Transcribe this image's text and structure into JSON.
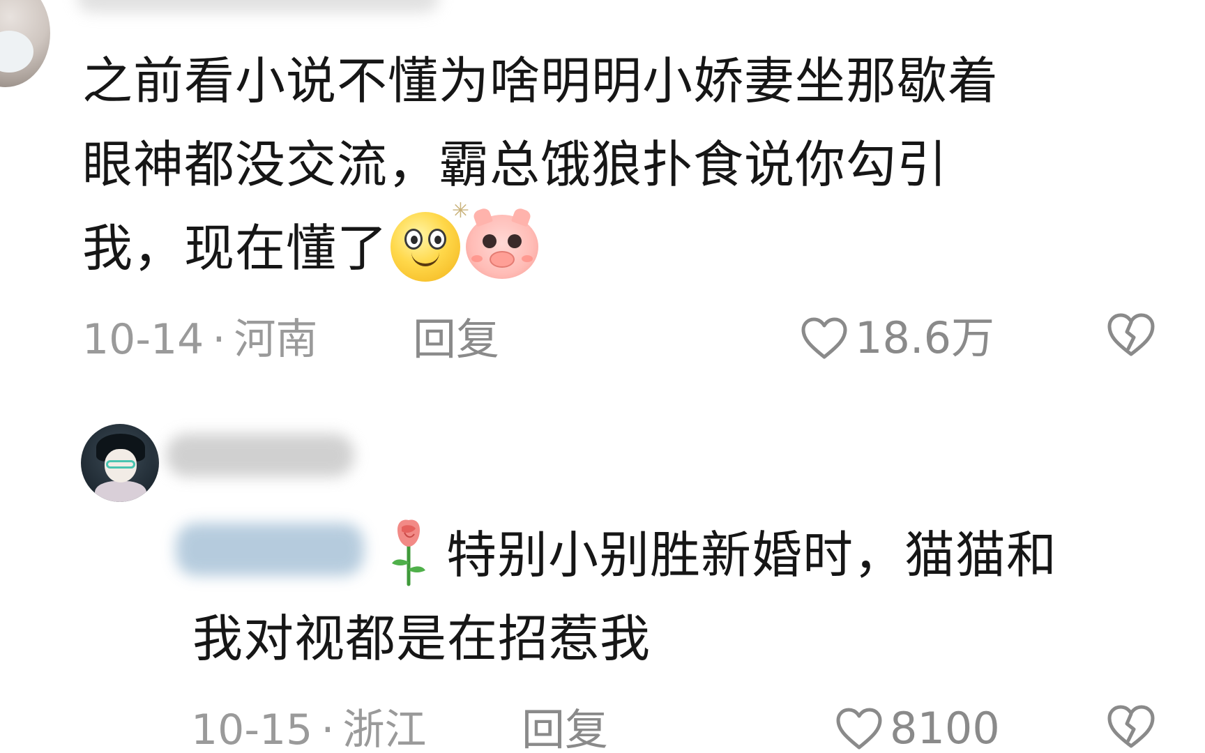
{
  "comments": [
    {
      "text_line_1": "之前看小说不懂为啥明明小娇妻坐那歇着",
      "text_line_2": "眼神都没交流，霸总饿狼扑食说你勾引",
      "text_line_3": "我，现在懂了",
      "emojis": [
        "dizzy-face-emoji",
        "pig-face-emoji"
      ],
      "date": "10-14",
      "separator": "·",
      "location": "河南",
      "reply_label": "回复",
      "likes": "18.6万"
    },
    {
      "text_line_1": "特别小别胜新婚时，猫猫和",
      "text_line_2": "我对视都是在招惹我",
      "emojis": [
        "rose-emoji"
      ],
      "date": "10-15",
      "separator": "·",
      "location": "浙江",
      "reply_label": "回复",
      "likes": "8100"
    }
  ],
  "icons": {
    "like": "heart-outline-icon",
    "dislike": "broken-heart-icon"
  },
  "colors": {
    "text": "#161616",
    "meta": "#9a9a9a",
    "icon": "#8a8a8a",
    "background": "#ffffff"
  }
}
